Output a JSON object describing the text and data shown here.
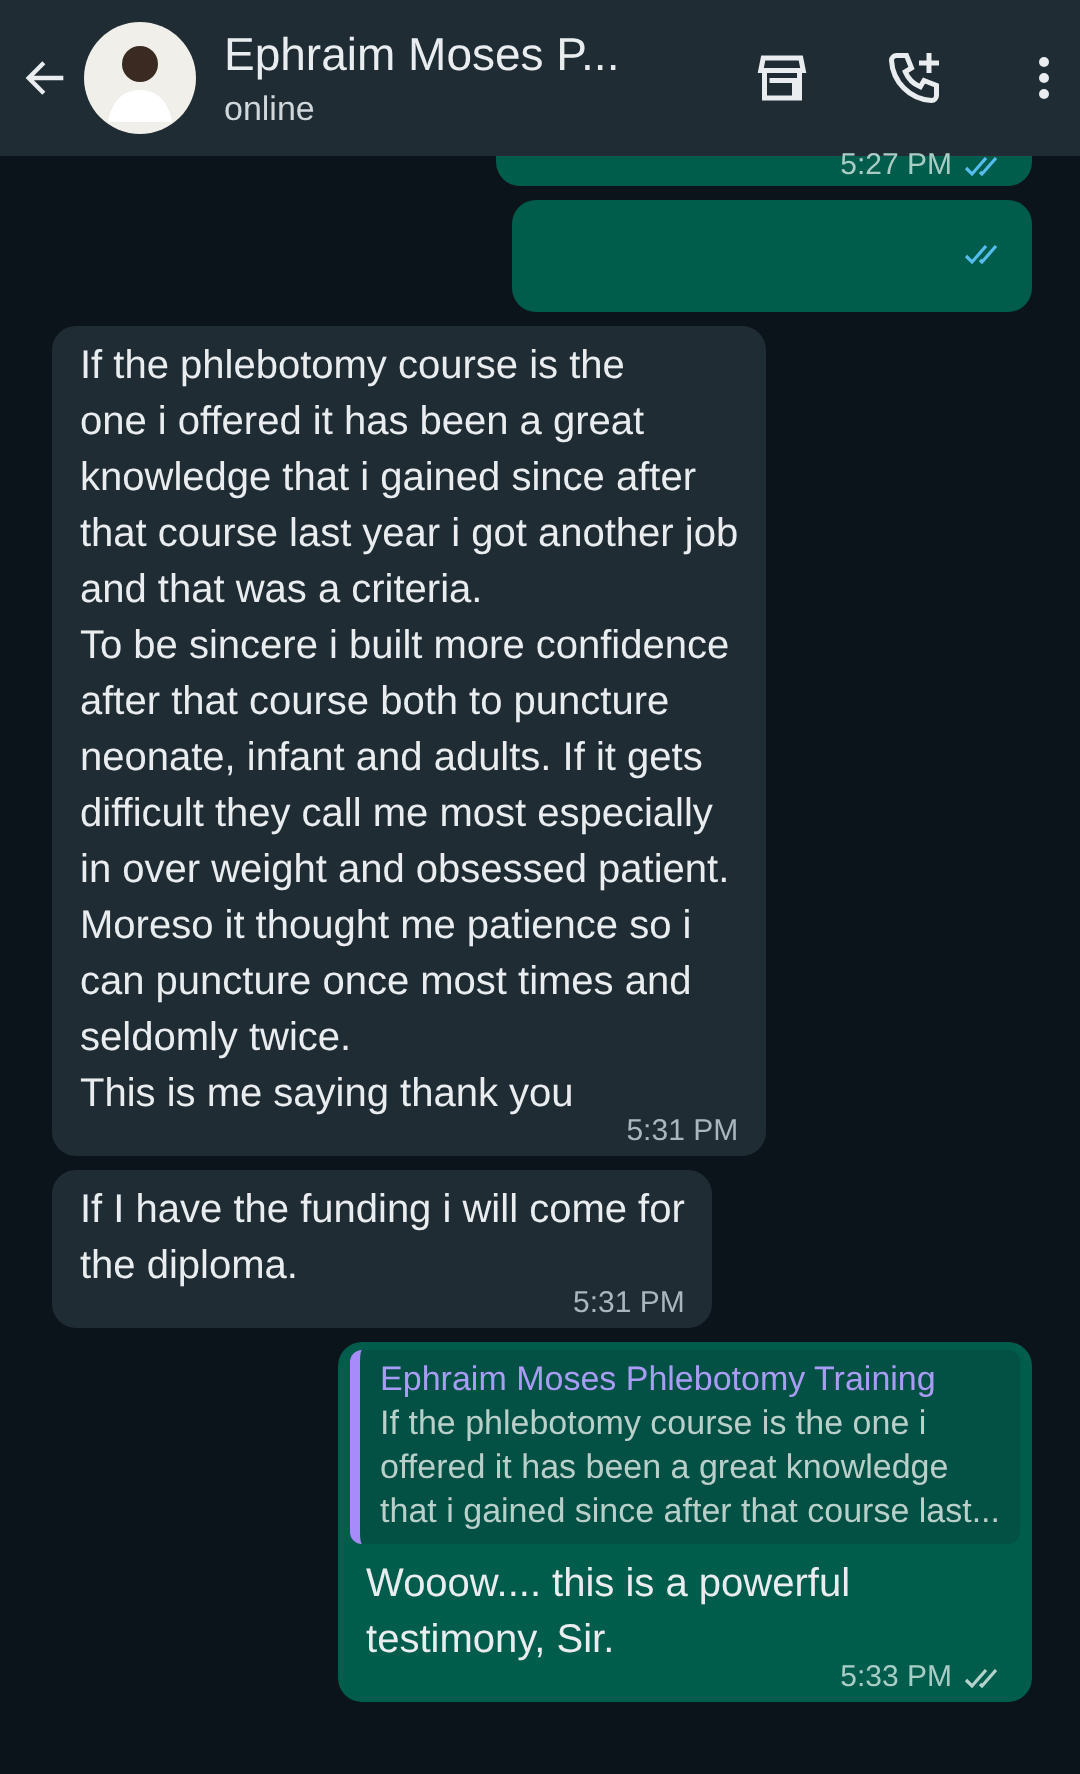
{
  "header": {
    "name": "Ephraim Moses P...",
    "status": "online"
  },
  "messages": [
    {
      "kind": "outgoing",
      "time": "5:27 PM",
      "read": true
    },
    {
      "kind": "outgoing",
      "read": true
    },
    {
      "kind": "incoming",
      "lines": [
        "If the phlebotomy course is the",
        "one i offered it has been a great",
        "knowledge that i gained since after",
        "that course last year i got another job",
        "and that was a criteria.",
        "To be sincere i built more confidence",
        "after that course both to puncture",
        "neonate, infant and adults. If it gets",
        "difficult they call me most especially",
        "in over weight and obsessed patient.",
        "Moreso it thought me patience so i",
        "can puncture once most times and",
        "seldomly twice.",
        "This is me saying thank you"
      ],
      "time": "5:31 PM"
    },
    {
      "kind": "incoming",
      "lines": [
        "If I have the funding i will come for",
        "the diploma."
      ],
      "time": "5:31 PM"
    },
    {
      "kind": "outgoing",
      "quote": {
        "author": "Ephraim Moses Phlebotomy Training",
        "lines": [
          "If the phlebotomy course is the one i",
          "offered it has been a great knowledge",
          "that i gained since after that course last..."
        ]
      },
      "lines": [
        "Wooow.... this is a powerful",
        "testimony, Sir."
      ],
      "time": "5:33 PM",
      "read": false
    }
  ]
}
